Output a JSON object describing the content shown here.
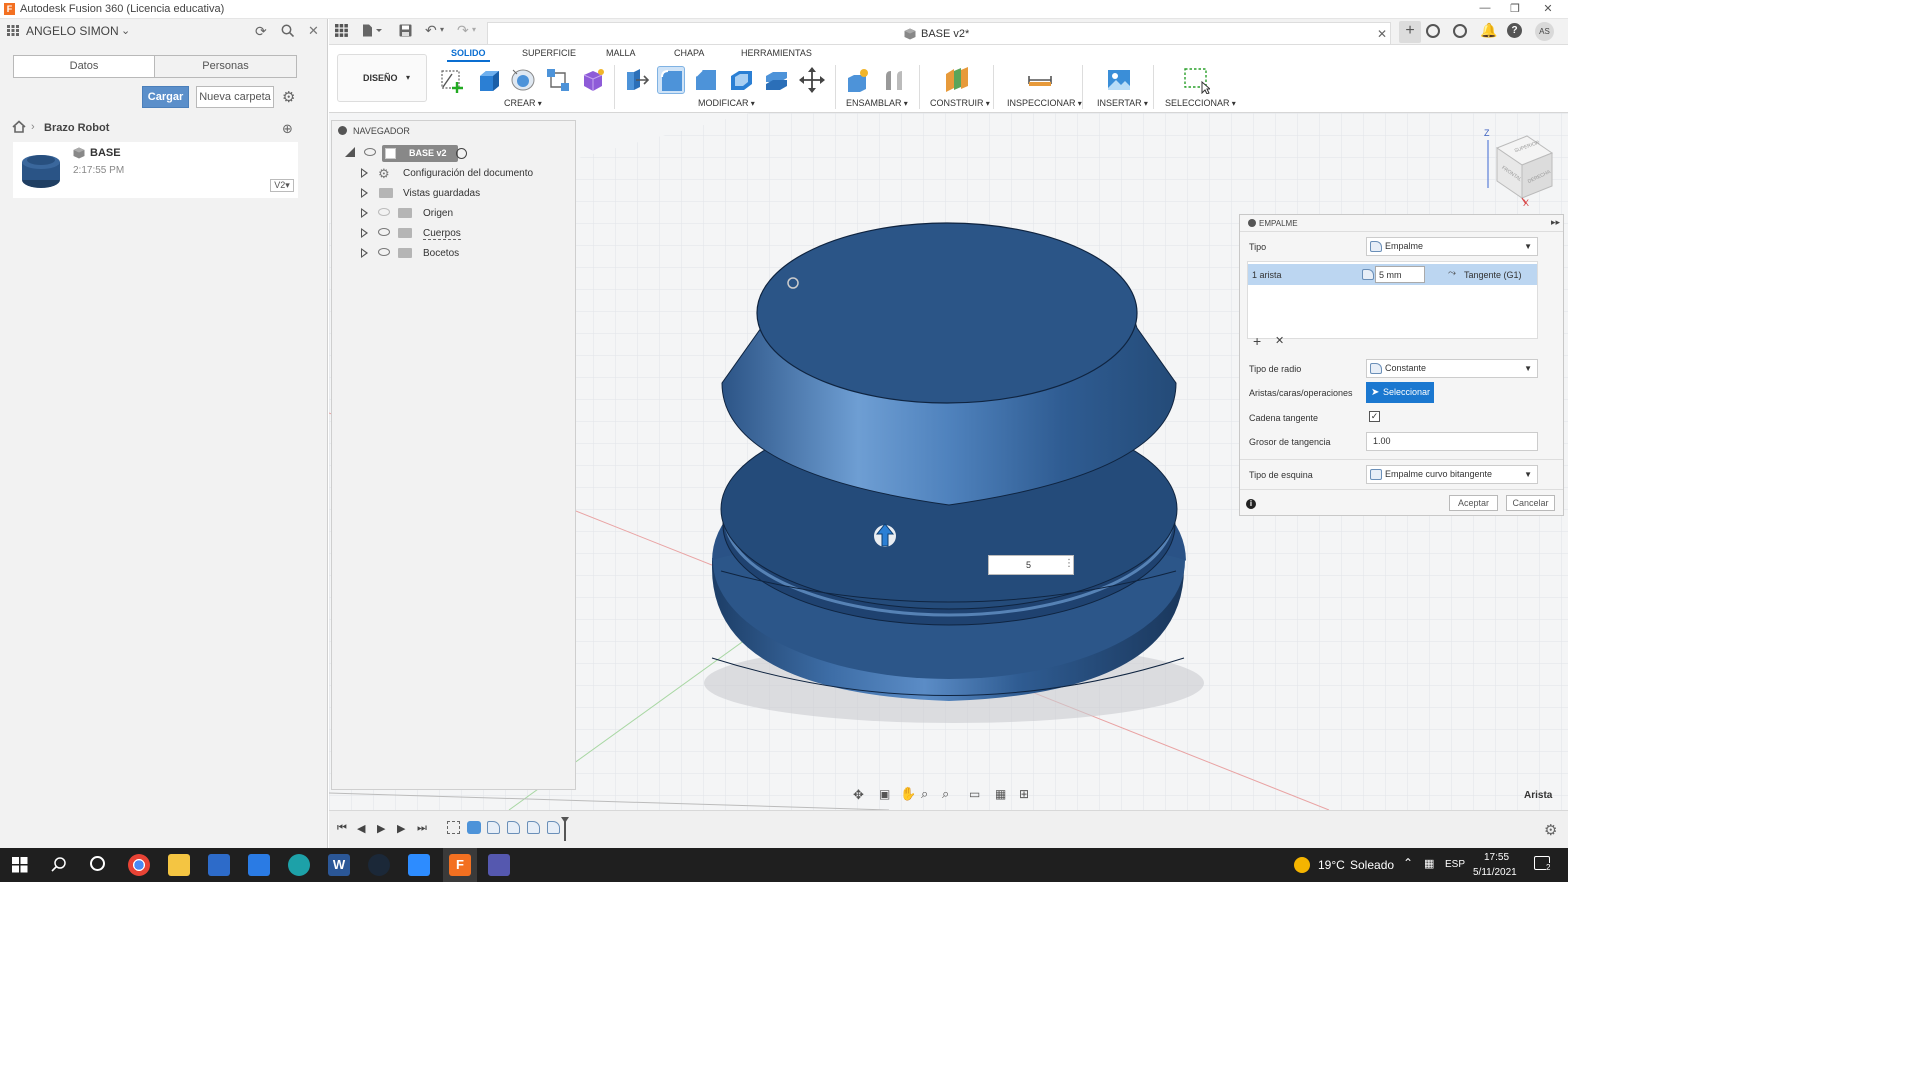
{
  "app": {
    "window_title": "Autodesk Fusion 360 (Licencia educativa)",
    "logo_letter": "F"
  },
  "data_panel": {
    "user_name": "ANGELO SIMON",
    "tabs": [
      "Datos",
      "Personas"
    ],
    "upload_label": "Cargar",
    "new_folder_label": "Nueva carpeta",
    "breadcrumb": "Brazo Robot",
    "file": {
      "name": "BASE",
      "time": "2:17:55 PM",
      "version": "V2"
    }
  },
  "document": {
    "tab_title": "BASE v2*",
    "user_initials": "AS"
  },
  "ribbon": {
    "workspace": "DISEÑO",
    "tabs": [
      "SOLIDO",
      "SUPERFICIE",
      "MALLA",
      "CHAPA",
      "HERRAMIENTAS"
    ],
    "active_tab": "SOLIDO",
    "groups": [
      "CREAR",
      "MODIFICAR",
      "ENSAMBLAR",
      "CONSTRUIR",
      "INSPECCIONAR",
      "INSERTAR",
      "SELECCIONAR"
    ]
  },
  "navigator": {
    "title": "NAVEGADOR",
    "root": "BASE v2",
    "items": [
      "Configuración del documento",
      "Vistas guardadas",
      "Origen",
      "Cuerpos",
      "Bocetos"
    ]
  },
  "viewcube": {
    "top": "SUPERIOR",
    "front": "FRONTAL",
    "right": "DERECHA",
    "axis_z": "Z",
    "axis_x": "X"
  },
  "dialog": {
    "title": "EMPALME",
    "tipo_label": "Tipo",
    "tipo_value": "Empalme",
    "edge_row": {
      "label": "1 arista",
      "radius": "5 mm",
      "continuity": "Tangente (G1)"
    },
    "radius_type_label": "Tipo de radio",
    "radius_type_value": "Constante",
    "selection_label": "Aristas/caras/operaciones",
    "selection_button": "Seleccionar",
    "tangent_chain_label": "Cadena tangente",
    "tangent_chain_checked": true,
    "tangency_weight_label": "Grosor de tangencia",
    "tangency_weight_value": "1.00",
    "corner_type_label": "Tipo de esquina",
    "corner_type_value": "Empalme curvo bitangente",
    "ok_label": "Aceptar",
    "cancel_label": "Cancelar"
  },
  "viewport": {
    "radius_input": "5",
    "status_text": "Arista"
  },
  "taskbar": {
    "weather_temp": "19°C",
    "weather_text": "Soleado",
    "language": "ESP",
    "time": "17:55",
    "date": "5/11/2021",
    "notifications": "2"
  }
}
